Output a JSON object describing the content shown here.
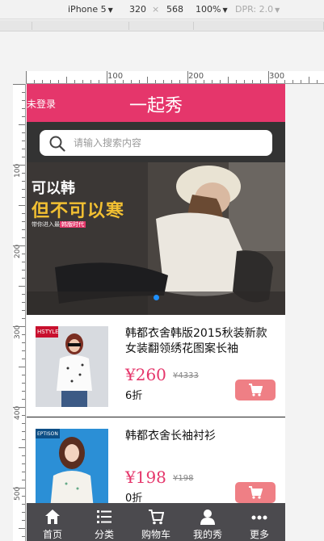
{
  "devtools": {
    "device": "iPhone 5",
    "width": "320",
    "times": "×",
    "height": "568",
    "zoom": "100%",
    "dpr": "DPR: 2.0"
  },
  "rulers": {
    "h_labels": [
      "100",
      "200",
      "300"
    ],
    "v_labels": [
      "100",
      "200",
      "300",
      "400",
      "500"
    ]
  },
  "header": {
    "login": "未登录",
    "title": "一起秀",
    "color": "#e5366b"
  },
  "search": {
    "placeholder": "请输入搜索内容"
  },
  "banner": {
    "line1": "可以韩",
    "line2": "但不可以寒",
    "line3_prefix": "带你进入最",
    "line3_highlight": "韩版时代"
  },
  "products": [
    {
      "name": "韩都衣舍韩版2015秋装新款女装翻领绣花图案长袖",
      "price": "¥260",
      "old_price": "¥4333",
      "discount": "6折",
      "thumb_tag": "HSTYLE"
    },
    {
      "name": "韩都衣舍长袖衬衫",
      "price": "¥198",
      "old_price": "¥198",
      "discount": "0折",
      "thumb_tag": "EPTISON"
    }
  ],
  "tabs": [
    {
      "label": "首页",
      "icon": "home-icon"
    },
    {
      "label": "分类",
      "icon": "list-icon"
    },
    {
      "label": "购物车",
      "icon": "cart-icon"
    },
    {
      "label": "我的秀",
      "icon": "user-icon"
    },
    {
      "label": "更多",
      "icon": "more-icon"
    }
  ]
}
